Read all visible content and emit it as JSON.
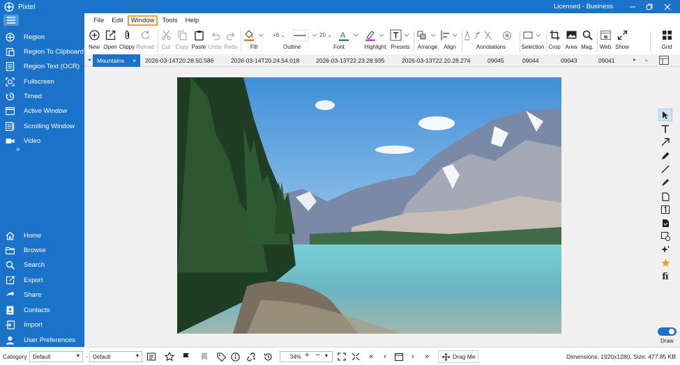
{
  "app": {
    "title": "Pixtel",
    "license": "Licensed - Business"
  },
  "colors": {
    "accent": "#1a73c8",
    "menu_highlight": "#f0a030"
  },
  "menu": [
    "File",
    "Edit",
    "Window",
    "Tools",
    "Help"
  ],
  "menu_active": "Window",
  "sidebar": {
    "capture": [
      "Region",
      "Region To Clipboard",
      "Region Text (OCR)",
      "Fullscreen",
      "Timed",
      "Active Window",
      "Scrolling Window",
      "Video"
    ],
    "more": "»",
    "nav": [
      "Home",
      "Browse",
      "Search",
      "Export",
      "Share",
      "Contacts",
      "Import",
      "User Preferences"
    ]
  },
  "toolbar": {
    "new": "New",
    "open": "Open",
    "clippy": "Clippy",
    "reload": "Reload",
    "cut": "Cut",
    "copy": "Copy",
    "paste": "Paste",
    "undo": "Undo",
    "redo": "Redo",
    "fill": "Fill",
    "outline": "Outline",
    "outline_width": "6",
    "font": "Font",
    "font_size": "20",
    "highlight": "Highlight",
    "presets": "Presets",
    "arrange": "Arrange",
    "align": "Align",
    "annotations": "Annotations",
    "selection": "Selection",
    "crop": "Crop",
    "area": "Area",
    "mag": "Mag.",
    "web": "Web",
    "show": "Show",
    "grid": "Grid"
  },
  "tabs": [
    "Mountains",
    "2026-03-14T20.28.50.586",
    "2026-03-14T20.24.54.018",
    "2026-03-13T22.23.28.935",
    "2026-03-13T22.20.28.274",
    "09045",
    "09044",
    "09043",
    "09041"
  ],
  "tab_close": "×",
  "right_panel": {
    "draw_label": "Draw"
  },
  "status": {
    "category_label": "Category",
    "category_value": "Default",
    "dash": "-",
    "second_value": "Default",
    "zoom": "34%",
    "drag_me": "Drag Me",
    "info": "Dimensions: 1920x1280, Size: 477.85 KB"
  }
}
